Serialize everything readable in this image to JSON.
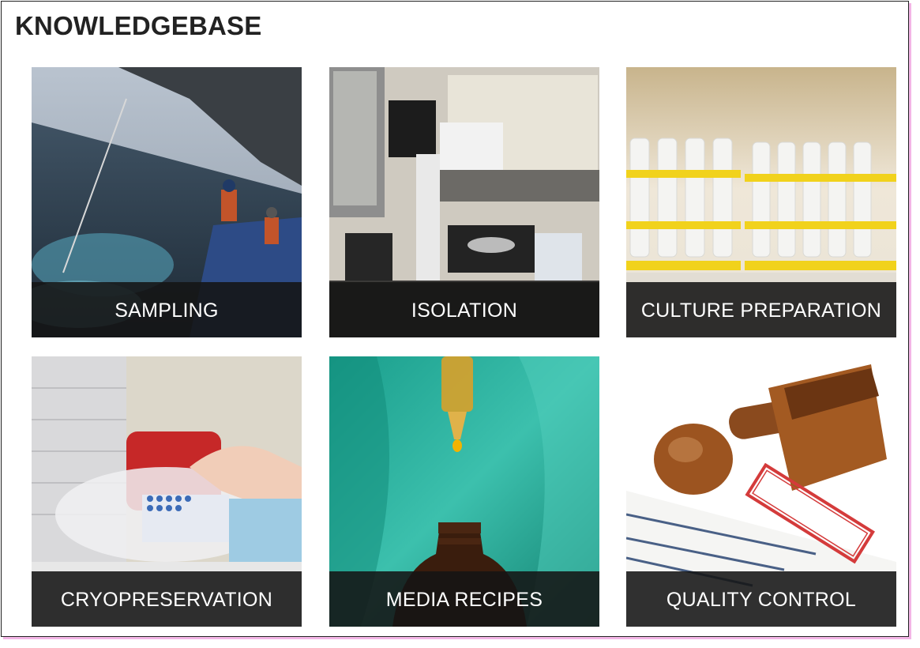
{
  "page": {
    "title": "KNOWLEDGEBASE"
  },
  "tiles": [
    {
      "label": "SAMPLING",
      "image": "sea-sampling-photo"
    },
    {
      "label": "ISOLATION",
      "image": "microscope-lab-photo"
    },
    {
      "label": "CULTURE PREPARATION",
      "image": "culture-tubes-rack-photo"
    },
    {
      "label": "CRYOPRESERVATION",
      "image": "cryo-vials-liquid-nitrogen-photo"
    },
    {
      "label": "MEDIA RECIPES",
      "image": "dropper-amber-bottle-photo"
    },
    {
      "label": "QUALITY CONTROL",
      "image": "approved-stamp-photo"
    }
  ],
  "colors": {
    "caption_bg": "#141414",
    "caption_text": "#ffffff",
    "title_text": "#222222"
  }
}
